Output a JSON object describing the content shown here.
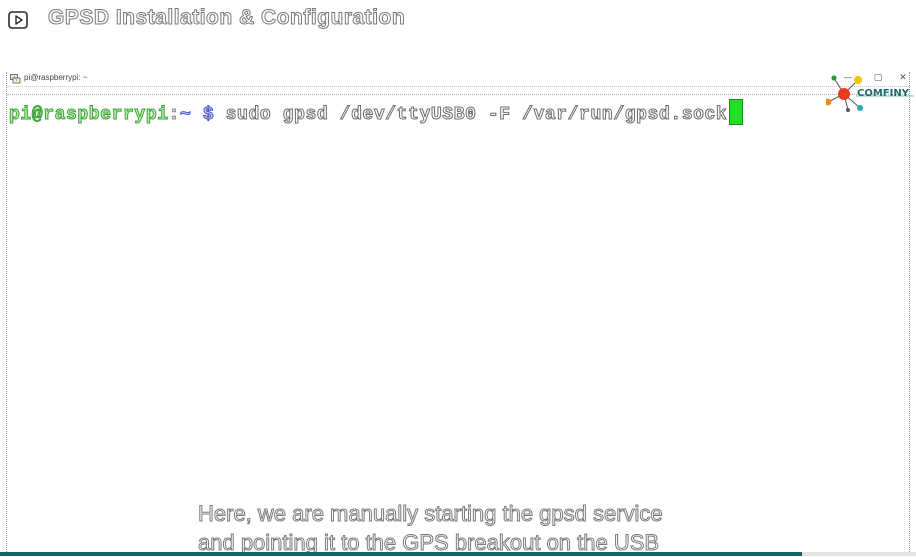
{
  "video": {
    "title": "GPSD Installation & Configuration",
    "progress_fraction": 0.875
  },
  "terminal": {
    "window_title": "pi@raspberrypi: ~",
    "prompt_user": "pi@raspberrypi",
    "prompt_sep": ":",
    "prompt_path": "~",
    "prompt_symbol": "$",
    "command": "sudo gpsd /dev/ttyUSB0 -F /var/run/gpsd.sock",
    "window_buttons": {
      "minimize": "—",
      "maximize": "▢",
      "close": "✕"
    }
  },
  "logo": {
    "text": "COMFINY"
  },
  "subtitle": {
    "lines": [
      "Here, we are manually starting the gpsd service",
      "and pointing it to the GPS breakout on the USB"
    ]
  },
  "colors": {
    "progress": "#126660",
    "cursor": "#22dd22",
    "prompt_user": "#3aa23a",
    "prompt_path": "#4a54c8"
  }
}
